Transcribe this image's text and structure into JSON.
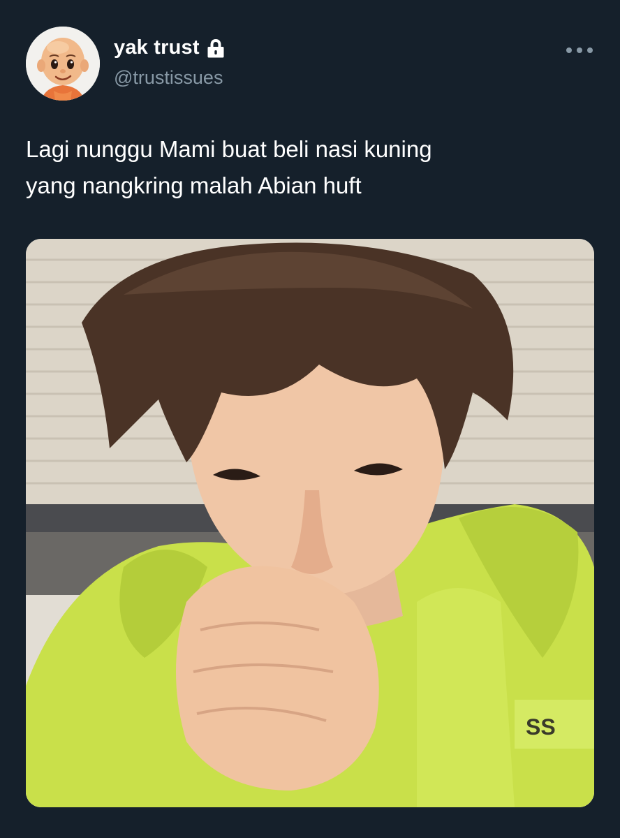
{
  "tweet": {
    "display_name": "yak trust",
    "handle": "@trustissues",
    "text": "Lagi nunggu Mami buat beli nasi kuning\nyang nangkring malah Abian huft",
    "protected_icon": "lock-icon",
    "more_icon": "more-horizontal-icon",
    "media_text": "SS",
    "colors": {
      "background": "#15202b",
      "primary_text": "#ffffff",
      "secondary_text": "#8899a6"
    }
  }
}
